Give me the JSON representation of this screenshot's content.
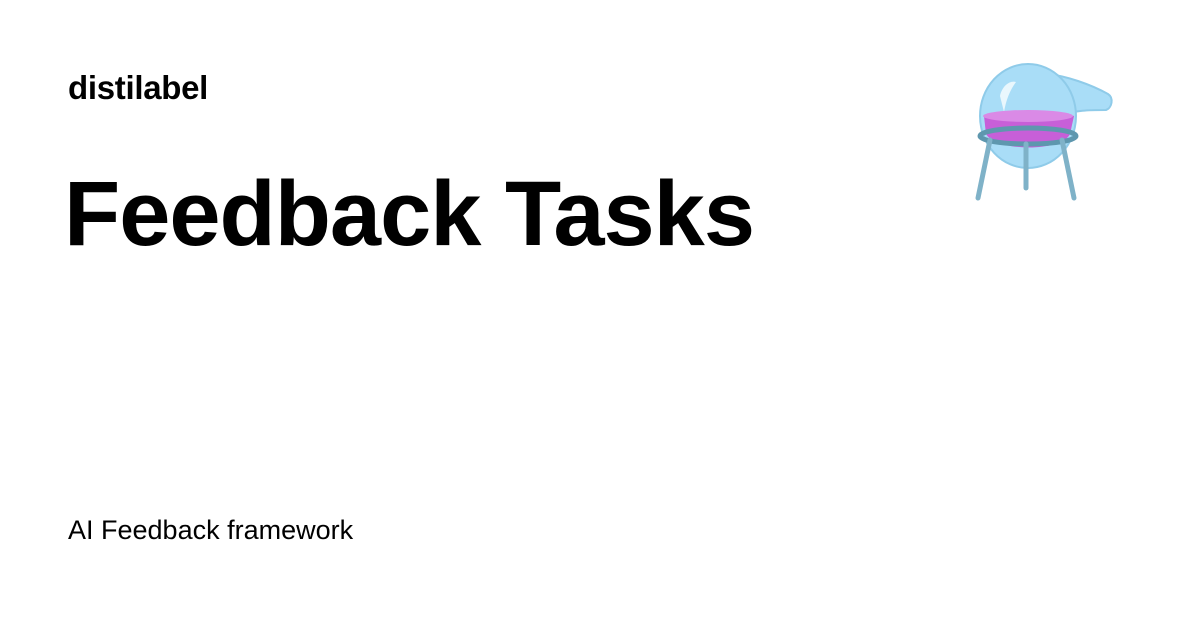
{
  "header": {
    "site_name": "distilabel"
  },
  "main": {
    "title": "Feedback Tasks",
    "tagline": "AI Feedback framework"
  },
  "logo": {
    "icon": "flask-icon",
    "colors": {
      "glass": "#a9ddf7",
      "liquid": "#c75fd8",
      "stand": "#7fb2c8"
    }
  }
}
